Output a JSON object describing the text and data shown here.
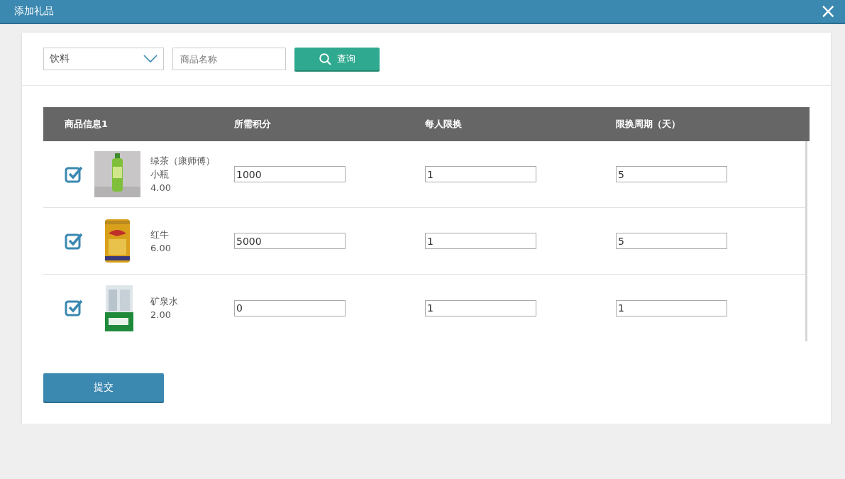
{
  "window": {
    "title": "添加礼品",
    "close_label": "×"
  },
  "filters": {
    "category": {
      "value": "饮料"
    },
    "search": {
      "placeholder": "商品名称"
    },
    "query_button": "查询"
  },
  "table": {
    "columns": [
      "商品信息1",
      "所需积分",
      "每人限换",
      "限换周期（天）"
    ],
    "rows": [
      {
        "checked": true,
        "name": "绿茶（康师傅）小瓶",
        "price": "4.00",
        "points": "1000",
        "limit": "1",
        "period": "5"
      },
      {
        "checked": true,
        "name": "红牛",
        "price": "6.00",
        "points": "5000",
        "limit": "1",
        "period": "5"
      },
      {
        "checked": true,
        "name": "矿泉水",
        "price": "2.00",
        "points": "0",
        "limit": "1",
        "period": "1"
      }
    ]
  },
  "submit_button": "提交"
}
